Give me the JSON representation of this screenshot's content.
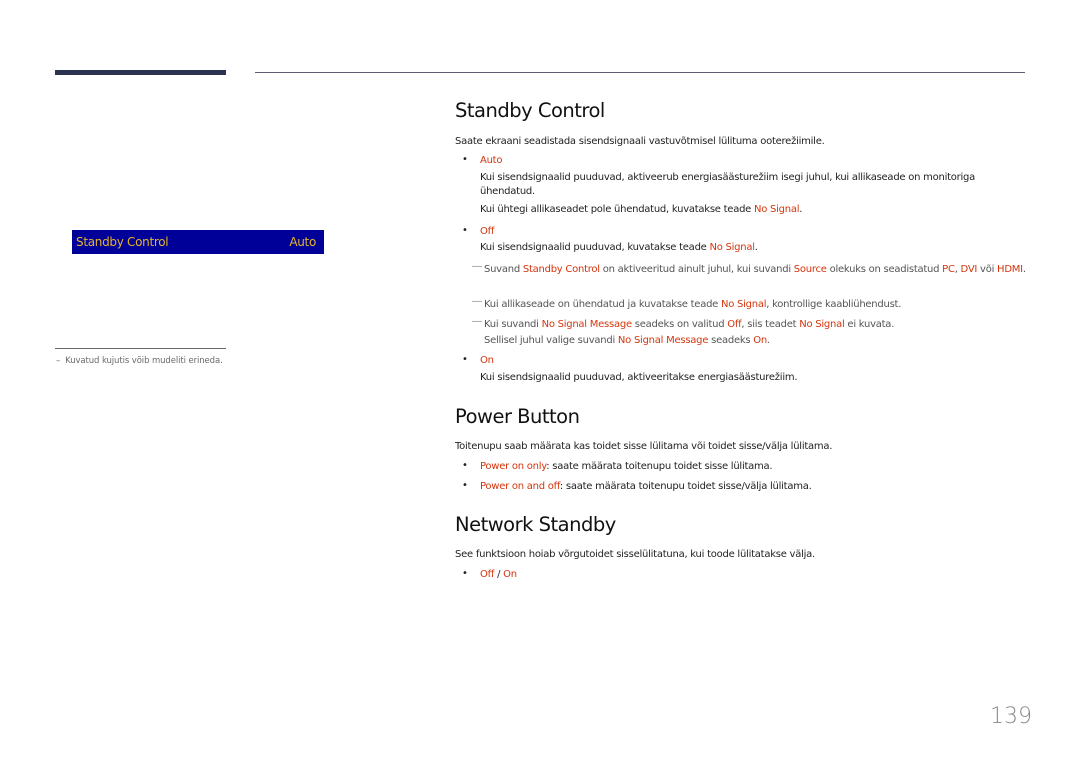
{
  "osd": {
    "item_label": "Standby Control",
    "item_value": "Auto"
  },
  "side_note": {
    "dash": "–",
    "text": "Kuvatud kujutis võib mudeliti erineda."
  },
  "sections": {
    "standby_control": {
      "title": "Standby Control",
      "intro": "Saate ekraani seadistada sisendsignaali vastuvõtmisel lülituma ooterežiimile.",
      "auto": {
        "label": "Auto",
        "desc1": "Kui sisendsignaalid puuduvad, aktiveerub energiasäästurežiim isegi juhul, kui allikaseade on monitoriga ühendatud.",
        "desc2_prefix": "Kui ühtegi allikaseadet pole ühendatud, kuvatakse teade ",
        "desc2_hl": "No Signal",
        "desc2_suffix": "."
      },
      "off": {
        "label": "Off",
        "desc_prefix": "Kui sisendsignaalid puuduvad, kuvatakse teade ",
        "desc_hl": "No Signal",
        "desc_suffix": "."
      },
      "notes": [
        {
          "mark": "―",
          "parts": [
            "Suvand ",
            "Standby Control",
            " on aktiveeritud ainult juhul, kui suvandi ",
            "Source",
            " olekuks on seadistatud ",
            "PC",
            ", ",
            "DVI",
            " või ",
            "HDMI",
            "."
          ]
        },
        {
          "mark": "―",
          "parts": [
            "Kui allikaseade on ühendatud ja kuvatakse teade ",
            "No Signal",
            ", kontrollige kaabliühendust."
          ]
        },
        {
          "mark": "―",
          "parts": [
            "Kui suvandi ",
            "No Signal Message",
            " seadeks on valitud ",
            "Off",
            ", siis teadet ",
            "No Signal",
            " ei kuvata."
          ],
          "parts2": [
            "Sellisel juhul valige suvandi ",
            "No Signal Message",
            " seadeks ",
            "On",
            "."
          ]
        }
      ],
      "on": {
        "label": "On",
        "desc": "Kui sisendsignaalid puuduvad, aktiveeritakse energiasäästurežiim."
      }
    },
    "power_button": {
      "title": "Power Button",
      "intro": "Toitenupu saab määrata kas toidet sisse lülitama või toidet sisse/välja lülitama.",
      "items": [
        {
          "label": "Power on only",
          "desc": ": saate määrata toitenupu toidet sisse lülitama."
        },
        {
          "label": "Power on and off",
          "desc": ": saate määrata toitenupu toidet sisse/välja lülitama."
        }
      ]
    },
    "network_standby": {
      "title": "Network Standby",
      "intro": "See funktsioon hoiab võrgutoidet sisselülitatuna, kui toode lülitatakse välja.",
      "options": {
        "off": "Off",
        "sep": " / ",
        "on": "On"
      }
    }
  },
  "bullet": "•",
  "page_number": "139",
  "colors": {
    "highlight": "#d4350d",
    "osd_bg": "#000099",
    "osd_text": "#e6b32a",
    "header_bar": "#2c3350"
  }
}
